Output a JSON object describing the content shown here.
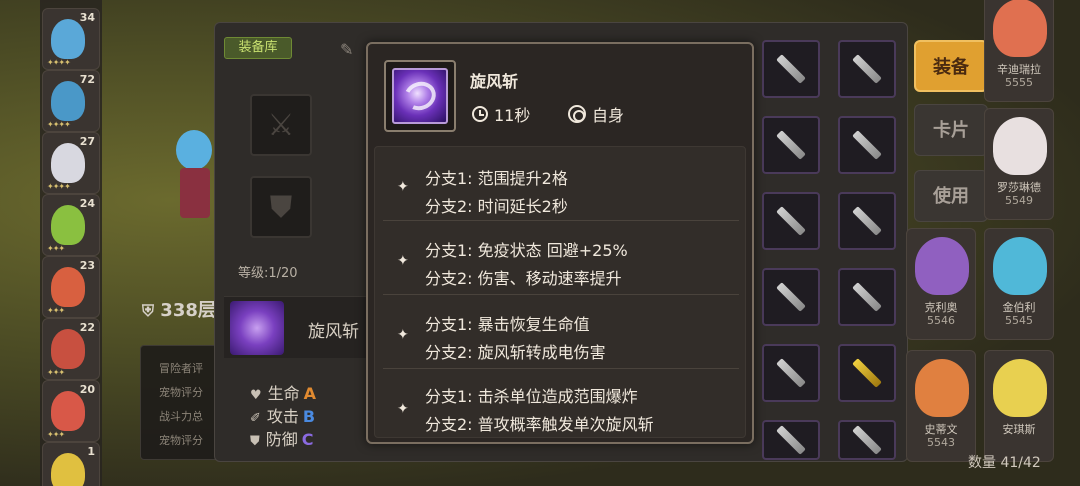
{
  "roster": {
    "levels": [
      "34",
      "72",
      "27",
      "24",
      "23",
      "22",
      "20",
      "1"
    ]
  },
  "map": {
    "floor": "338层"
  },
  "info_box": {
    "lines": [
      "冒险者评",
      "宠物评分",
      "战斗力总",
      "宠物评分"
    ]
  },
  "equip_panel": {
    "tab_label": "装备库",
    "level": "等级:1/20",
    "skill_name": "旋风斩",
    "stats": [
      {
        "label": "生命",
        "grade": "A",
        "color": "#e08a30"
      },
      {
        "label": "攻击",
        "grade": "B",
        "color": "#4a8ae0"
      },
      {
        "label": "防御",
        "grade": "C",
        "color": "#8a6ae0"
      }
    ]
  },
  "side_buttons": {
    "equip": "装备",
    "card": "卡片",
    "use": "使用"
  },
  "heroes": [
    {
      "name": "辛迪瑞拉",
      "power": "5555"
    },
    {
      "name": "罗莎琳德",
      "power": "5549"
    },
    {
      "name": "克利奥",
      "power": "5546"
    },
    {
      "name": "金伯利",
      "power": "5545"
    },
    {
      "name": "史蒂文",
      "power": "5543"
    },
    {
      "name": "安琪斯",
      "power": ""
    }
  ],
  "inventory_count": "数量 41/42",
  "tooltip": {
    "title": "旋风斩",
    "duration": "11秒",
    "target": "自身",
    "branches": [
      {
        "line1": "分支1: 范围提升2格",
        "line2": "分支2: 时间延长2秒"
      },
      {
        "line1": "分支1: 免疫状态 回避+25%",
        "line2": "分支2: 伤害、移动速率提升"
      },
      {
        "line1": "分支1: 暴击恢复生命值",
        "line2": "分支2: 旋风斩转成电伤害"
      },
      {
        "line1": "分支1: 击杀单位造成范围爆炸",
        "line2": "分支2: 普攻概率触发单次旋风斩"
      }
    ]
  },
  "colors": {
    "accent_gold": "#e0a030",
    "tab_green": "#c8e070",
    "tooltip_border": "#7a6e60"
  }
}
